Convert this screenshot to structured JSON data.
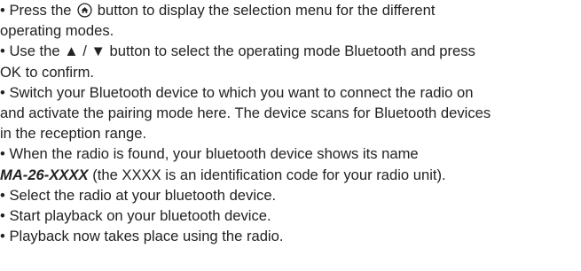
{
  "instructions": {
    "bullet": "•",
    "item1": {
      "line1_before": "Press the ",
      "icon": "home-button-icon",
      "line1_after": " button to display the selection menu for the different",
      "line2": "operating modes."
    },
    "item2": {
      "line1": "Use the ▲ / ▼ button to select the operating mode Bluetooth and press",
      "line2": "OK to confirm."
    },
    "item3": {
      "line1": "Switch your Bluetooth device to which you want to connect the radio on",
      "line2": "and activate the pairing mode here. The device scans for Bluetooth devices",
      "line3": "in the reception range."
    },
    "item4": {
      "line1": "When the radio is found, your bluetooth device shows its name",
      "device_name": "MA-26-XXXX",
      "line2_after": " (the XXXX is an identification code for your radio unit)."
    },
    "item5": {
      "line1": "Select the radio at your bluetooth device."
    },
    "item6": {
      "line1": "Start playback on your bluetooth device."
    },
    "item7": {
      "line1": "Playback now takes place using the radio."
    }
  }
}
